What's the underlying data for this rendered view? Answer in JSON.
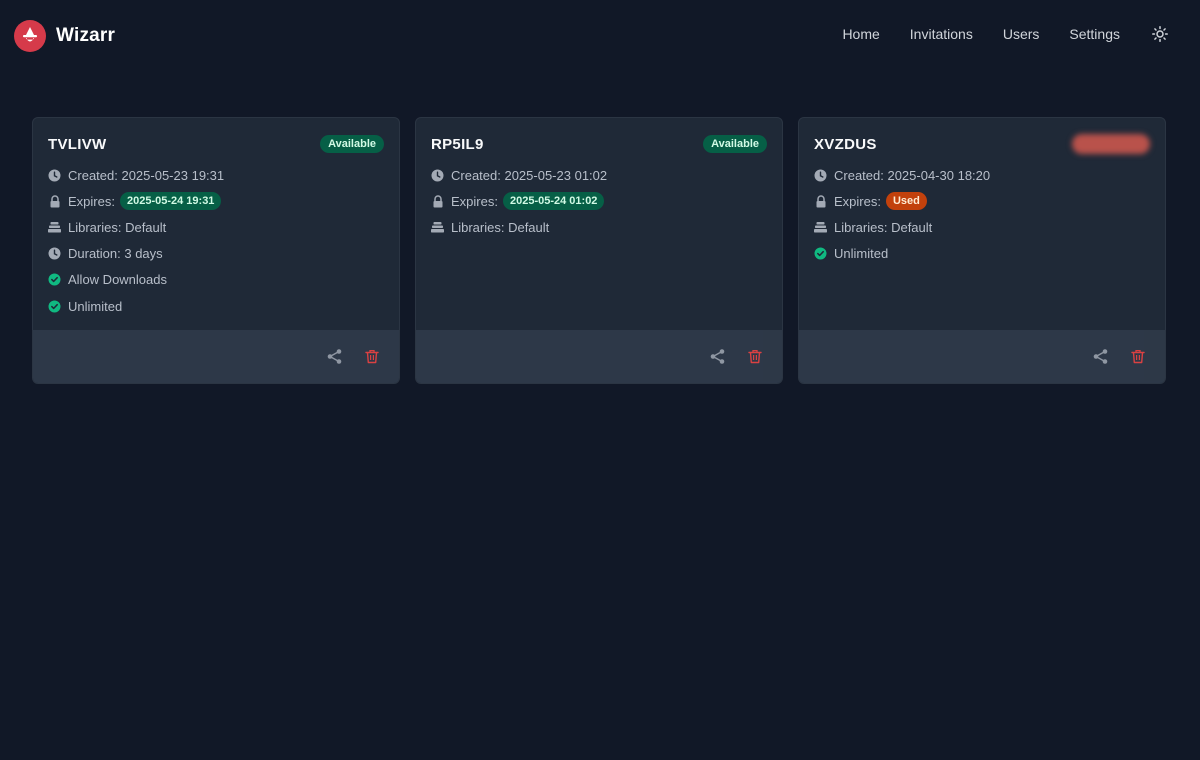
{
  "app": {
    "name": "Wizarr"
  },
  "nav": {
    "links": [
      "Home",
      "Invitations",
      "Users",
      "Settings"
    ],
    "theme_icon": "sun-icon"
  },
  "colors": {
    "background": "#111827",
    "card": "#1f2937",
    "card_footer": "#2f3a4a",
    "brand": "#d63a4a",
    "available": "#065f46",
    "used": "#c2410c",
    "delete": "#ef4444"
  },
  "invitations": [
    {
      "code": "TVLIVW",
      "status": "Available",
      "created": "Created: 2025-05-23 19:31",
      "expires_label": "Expires:",
      "expires_value": "2025-05-24 19:31",
      "libraries": "Libraries: Default",
      "duration": "Duration: 3 days",
      "downloads": "Allow Downloads",
      "unlimited": "Unlimited"
    },
    {
      "code": "RP5IL9",
      "status": "Available",
      "created": "Created: 2025-05-23 01:02",
      "expires_label": "Expires:",
      "expires_value": "2025-05-24 01:02",
      "libraries": "Libraries: Default"
    },
    {
      "code": "XVZDUS",
      "status": "",
      "created": "Created: 2025-04-30 18:20",
      "expires_label": "Expires:",
      "expires_value": "Used",
      "libraries": "Libraries: Default",
      "unlimited": "Unlimited"
    }
  ]
}
